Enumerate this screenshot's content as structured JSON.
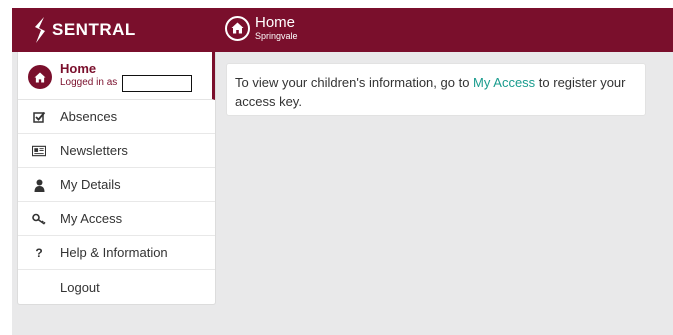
{
  "header": {
    "brand": "SENTRAL",
    "page_title": "Home",
    "page_subtitle": "Springvale",
    "background_color": "#7a0f2c"
  },
  "sidebar": {
    "home": {
      "label": "Home",
      "sublabel": "Logged in as",
      "icon": "home-icon"
    },
    "items": [
      {
        "label": "Absences",
        "icon": "checkbox-icon"
      },
      {
        "label": "Newsletters",
        "icon": "newspaper-icon"
      },
      {
        "label": "My Details",
        "icon": "user-icon"
      },
      {
        "label": "My Access",
        "icon": "key-icon"
      },
      {
        "label": "Help & Information",
        "icon": "question-icon"
      },
      {
        "label": "Logout",
        "icon": ""
      }
    ]
  },
  "main": {
    "message_before": "To view your children's information, go to ",
    "message_link": "My Access",
    "message_after": " to register your access key.",
    "link_color": "#1a9c8e"
  }
}
